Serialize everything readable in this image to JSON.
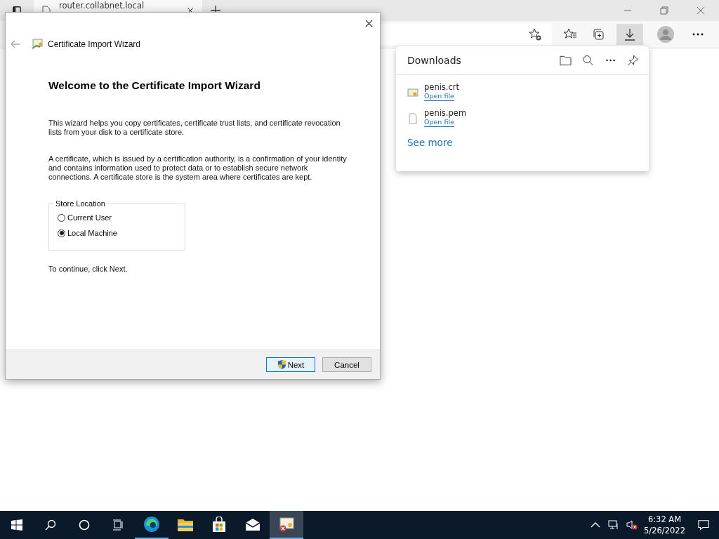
{
  "browser": {
    "tab": {
      "title": "router.collabnet.local"
    }
  },
  "downloads": {
    "title": "Downloads",
    "items": [
      {
        "kind": "certificate",
        "name": "penis.crt",
        "action": "Open file"
      },
      {
        "kind": "file",
        "name": "penis.pem",
        "action": "Open file"
      }
    ],
    "see_more": "See more"
  },
  "dialog": {
    "title": "Certificate Import Wizard",
    "heading": "Welcome to the Certificate Import Wizard",
    "paragraphs": [
      "This wizard helps you copy certificates, certificate trust lists, and certificate revocation lists from your disk to a certificate store.",
      "A certificate, which is issued by a certification authority, is a confirmation of your identity and contains information used to protect data or to establish secure network connections. A certificate store is the system area where certificates are kept."
    ],
    "store_location": {
      "label": "Store Location",
      "options": [
        {
          "label": "Current User",
          "selected": false
        },
        {
          "label": "Local Machine",
          "selected": true
        }
      ]
    },
    "footer_text": "To continue, click Next.",
    "buttons": [
      {
        "label": "Next",
        "kind": "primary"
      },
      {
        "label": "Cancel",
        "kind": "default"
      }
    ]
  },
  "taskbar": {
    "apps": [
      {
        "kind": "edge",
        "running": true,
        "active": false
      },
      {
        "kind": "explorer",
        "running": false,
        "active": false
      },
      {
        "kind": "store",
        "running": false,
        "active": false
      },
      {
        "kind": "mail",
        "running": false,
        "active": false
      },
      {
        "kind": "certificate",
        "running": true,
        "active": true
      }
    ],
    "time": "6:32 AM",
    "date": "5/26/2022"
  }
}
